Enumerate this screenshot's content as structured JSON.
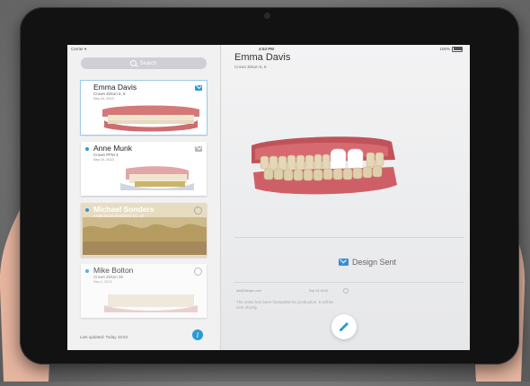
{
  "status_bar": {
    "carrier": "Carrier ▾",
    "time": "4:53 PM",
    "battery": "100%"
  },
  "sidebar": {
    "search_placeholder": "Search",
    "patients": [
      {
        "name": "Emma Davis",
        "subtitle": "Crown Zirkon 6, 8",
        "date": "Sep 24, 2013",
        "icon": "mail-icon",
        "selected": true
      },
      {
        "name": "Anne Munk",
        "subtitle": "Crown PFM 3",
        "date": "Sep 19, 2013",
        "icon": "mail-icon",
        "selected": false
      },
      {
        "name": "Michael Sonders",
        "subtitle": "Anatomical Abutment 21, 22",
        "date": "Sep 12, 2013",
        "icon": "circle-icon",
        "selected": false
      },
      {
        "name": "Mike Bolton",
        "subtitle": "Crown Zirkon 36",
        "date": "Sep 4, 2013",
        "icon": "circle-icon",
        "selected": false
      }
    ],
    "last_updated": "Last updated: Today 16:53",
    "info_label": "i"
  },
  "detail": {
    "patient_name": "Emma Davis",
    "subtitle": "Crown Zirkon 6, 8",
    "status_label": "Design Sent",
    "message_email": "lab@3shape.com",
    "message_time": "Sep 24 16:52",
    "message_text": "The order has been forwarded for production. It will be sent shortly."
  },
  "colors": {
    "accent": "#2a9ad6",
    "gum": "#c9585e",
    "tooth": "#e8ddc4",
    "crown": "#ffffff"
  }
}
